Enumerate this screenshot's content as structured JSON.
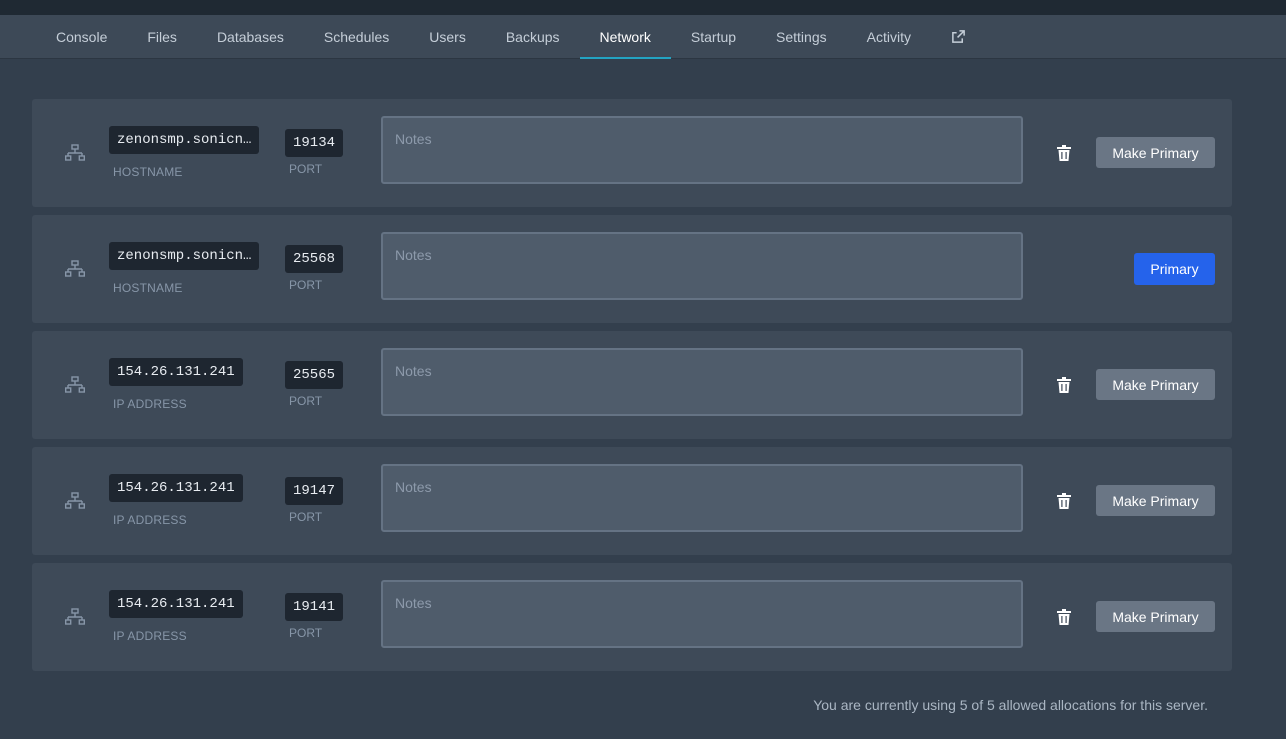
{
  "tabs": [
    {
      "label": "Console"
    },
    {
      "label": "Files"
    },
    {
      "label": "Databases"
    },
    {
      "label": "Schedules"
    },
    {
      "label": "Users"
    },
    {
      "label": "Backups"
    },
    {
      "label": "Network",
      "active": true
    },
    {
      "label": "Startup"
    },
    {
      "label": "Settings"
    },
    {
      "label": "Activity"
    }
  ],
  "allocations": [
    {
      "host": "zenonsmp.sonicn…",
      "host_label": "HOSTNAME",
      "port": "19134",
      "port_label": "PORT",
      "notes_placeholder": "Notes",
      "action_label": "Make Primary"
    },
    {
      "host": "zenonsmp.sonicn…",
      "host_label": "HOSTNAME",
      "port": "25568",
      "port_label": "PORT",
      "notes_placeholder": "Notes",
      "action_label": "Primary"
    },
    {
      "host": "154.26.131.241",
      "host_label": "IP ADDRESS",
      "port": "25565",
      "port_label": "PORT",
      "notes_placeholder": "Notes",
      "action_label": "Make Primary"
    },
    {
      "host": "154.26.131.241",
      "host_label": "IP ADDRESS",
      "port": "19147",
      "port_label": "PORT",
      "notes_placeholder": "Notes",
      "action_label": "Make Primary"
    },
    {
      "host": "154.26.131.241",
      "host_label": "IP ADDRESS",
      "port": "19141",
      "port_label": "PORT",
      "notes_placeholder": "Notes",
      "action_label": "Make Primary"
    }
  ],
  "footer": {
    "usage_text": "You are currently using 5 of 5 allowed allocations for this server."
  },
  "colors": {
    "accent": "#23a3c2",
    "primary_button": "#2563eb",
    "make_primary_button": "#6a7685"
  }
}
